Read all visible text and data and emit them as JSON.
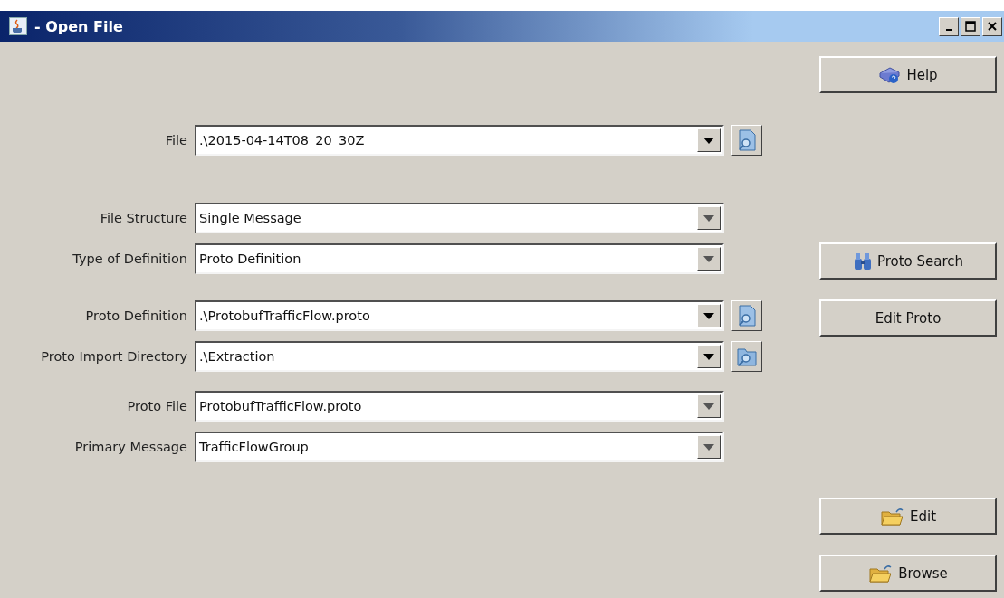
{
  "window": {
    "title": "- Open File"
  },
  "field_groups": [
    [
      {
        "label": "File",
        "value": ".\\2015-04-14T08_20_30Z",
        "kind": "file"
      }
    ],
    [
      {
        "label": "File Structure",
        "value": "Single Message",
        "kind": "choice"
      },
      {
        "label": "Type of Definition",
        "value": "Proto Definition",
        "kind": "choice"
      }
    ],
    [
      {
        "label": "Proto Definition",
        "value": ".\\ProtobufTrafficFlow.proto",
        "kind": "file"
      },
      {
        "label": "Proto Import Directory",
        "value": ".\\Extraction",
        "kind": "folder"
      }
    ],
    [
      {
        "label": "Proto File",
        "value": "ProtobufTrafficFlow.proto",
        "kind": "choice"
      },
      {
        "label": "Primary Message",
        "value": "TrafficFlowGroup",
        "kind": "choice"
      }
    ]
  ],
  "button_groups": [
    [
      {
        "label": "Help",
        "kind": "help"
      }
    ],
    [
      {
        "label": "Proto Search",
        "kind": "search"
      },
      {
        "label": "Edit Proto",
        "kind": "plain"
      }
    ],
    [
      {
        "label": "Edit",
        "kind": "folder"
      },
      {
        "label": "Browse",
        "kind": "folder"
      }
    ]
  ]
}
